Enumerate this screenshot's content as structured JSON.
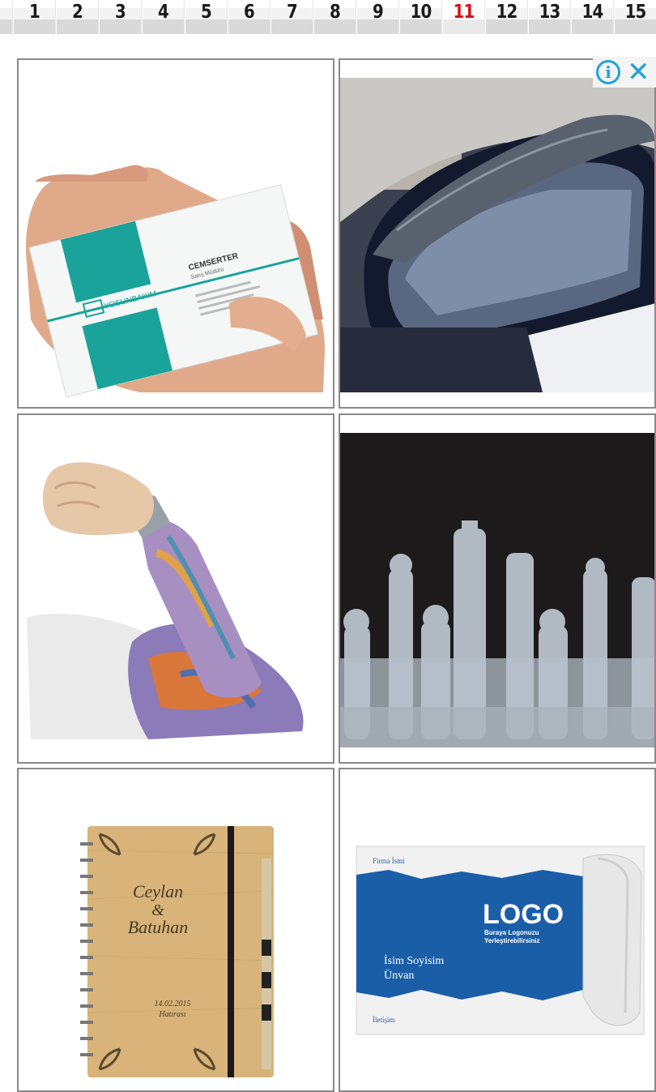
{
  "pagination": {
    "pages": [
      "1",
      "2",
      "3",
      "4",
      "5",
      "6",
      "7",
      "8",
      "9",
      "10",
      "11",
      "12",
      "13",
      "14",
      "15"
    ],
    "current": "11",
    "colors": {
      "active": "#d6101a",
      "normal": "#1b1b1b"
    }
  },
  "ad_choices": {
    "info_icon": "info-icon",
    "close_icon": "close-icon",
    "color": "#21a3da"
  },
  "products": {
    "business_card": {
      "brand": "YOSUNBAKIM",
      "name": "CEMSERTER",
      "title": "Satış Müdürü"
    },
    "notebook": {
      "line1": "Ceylan",
      "line2": "&",
      "line3": "Batuhan",
      "date": "14.02.2015",
      "caption": "Hatırası"
    },
    "card_template": {
      "company": "Firma İsmi",
      "logo": "LOGO",
      "logo_sub1": "Buraya Logonuzu",
      "logo_sub2": "Yerleştirebilirsiniz",
      "name": "İsim Soyisim",
      "title": "Ünvan",
      "contact": "İletişim"
    }
  }
}
